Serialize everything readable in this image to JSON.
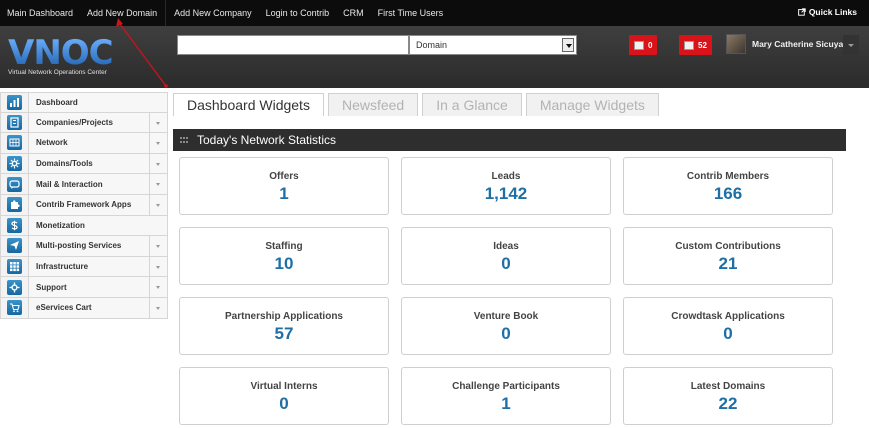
{
  "topnav": {
    "links": [
      "Main Dashboard",
      "Add New Domain",
      "Add New Company",
      "Login to Contrib",
      "CRM",
      "First Time Users"
    ],
    "quick_links": "Quick Links"
  },
  "header": {
    "logo_text": "VNOC",
    "logo_subtitle": "Virtual Network Operations Center",
    "search_value": "",
    "domain_select": "Domain",
    "badge_alerts": "0",
    "badge_messages": "52",
    "user_name": "Mary Catherine Sicuya"
  },
  "sidebar": {
    "items": [
      {
        "label": "Dashboard",
        "icon": "chart-icon",
        "caret": false
      },
      {
        "label": "Companies/Projects",
        "icon": "building-icon",
        "caret": true
      },
      {
        "label": "Network",
        "icon": "grid-network-icon",
        "caret": true
      },
      {
        "label": "Domains/Tools",
        "icon": "gear-icon",
        "caret": true
      },
      {
        "label": "Mail & Interaction",
        "icon": "chat-icon",
        "caret": true
      },
      {
        "label": "Contrib Framework Apps",
        "icon": "puzzle-icon",
        "caret": true
      },
      {
        "label": "Monetization",
        "icon": "dollar-icon",
        "caret": false
      },
      {
        "label": "Multi-posting Services",
        "icon": "send-icon",
        "caret": true
      },
      {
        "label": "Infrastructure",
        "icon": "grid-icon",
        "caret": true
      },
      {
        "label": "Support",
        "icon": "cog-support-icon",
        "caret": true
      },
      {
        "label": "eServices Cart",
        "icon": "cart-icon",
        "caret": true
      }
    ]
  },
  "tabs": [
    {
      "label": "Dashboard Widgets",
      "active": true
    },
    {
      "label": "Newsfeed",
      "active": false
    },
    {
      "label": "In a Glance",
      "active": false
    },
    {
      "label": "Manage Widgets",
      "active": false
    }
  ],
  "panel": {
    "title": "Today's Network Statistics"
  },
  "stats": [
    {
      "label": "Offers",
      "value": "1"
    },
    {
      "label": "Leads",
      "value": "1,142"
    },
    {
      "label": "Contrib Members",
      "value": "166"
    },
    {
      "label": "Staffing",
      "value": "10"
    },
    {
      "label": "Ideas",
      "value": "0"
    },
    {
      "label": "Custom Contributions",
      "value": "21"
    },
    {
      "label": "Partnership Applications",
      "value": "57"
    },
    {
      "label": "Venture Book",
      "value": "0"
    },
    {
      "label": "Crowdtask Applications",
      "value": "0"
    },
    {
      "label": "Virtual Interns",
      "value": "0"
    },
    {
      "label": "Challenge Participants",
      "value": "1"
    },
    {
      "label": "Latest Domains",
      "value": "22"
    }
  ],
  "colors": {
    "accent_blue": "#1d6fa5",
    "badge_red": "#d8141a",
    "annotation_red": "#d0121b"
  }
}
